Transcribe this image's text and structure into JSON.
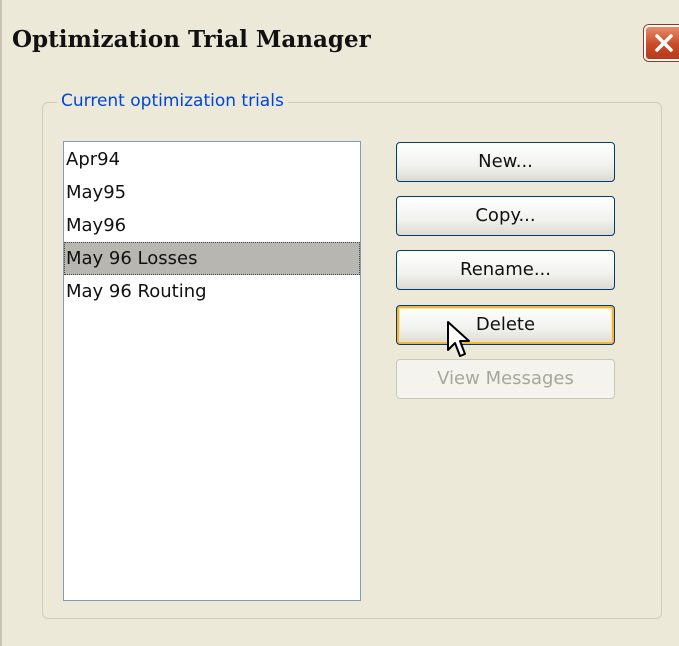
{
  "window": {
    "title": "Optimization Trial Manager"
  },
  "group": {
    "label": "Current optimization trials"
  },
  "trials": {
    "items": [
      "Apr94",
      "May95",
      "May96",
      "May 96 Losses",
      "May 96 Routing"
    ],
    "selected": "May 96 Losses"
  },
  "buttons": {
    "new_label": "New...",
    "copy_label": "Copy...",
    "rename_label": "Rename...",
    "delete_label": "Delete",
    "view_messages_label": "View Messages"
  },
  "colors": {
    "dialog_background": "#ece9d8",
    "group_label": "#0046d5",
    "close_button": "#c94b29",
    "selection": "#b8b6b0",
    "focus_ring": "#f8b334"
  },
  "icons": {
    "close": "close-icon",
    "cursor": "mouse-pointer-icon"
  }
}
